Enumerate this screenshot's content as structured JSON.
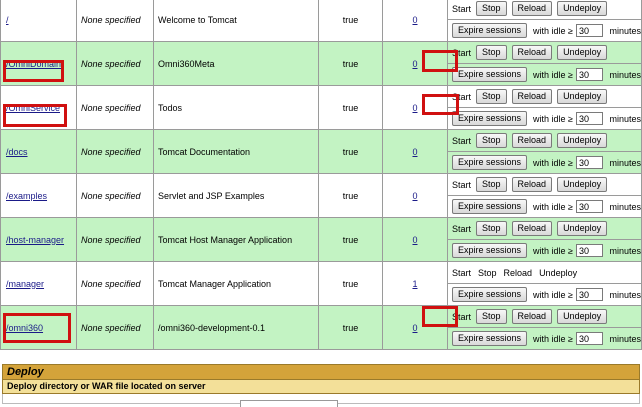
{
  "labels": {
    "start": "Start",
    "stop": "Stop",
    "reload": "Reload",
    "undeploy": "Undeploy",
    "expire": "Expire sessions",
    "with_idle": "with idle ≥",
    "minutes": "minutes",
    "idle_default": "30"
  },
  "apps": [
    {
      "path": "/",
      "version": "None specified",
      "display": "Welcome to Tomcat",
      "running": "true",
      "sessions": "0",
      "style": "white",
      "stop_disabled": false
    },
    {
      "path": "/OmniDomain",
      "version": "None specified",
      "display": "Omni360Meta",
      "running": "true",
      "sessions": "0",
      "style": "green",
      "stop_disabled": false
    },
    {
      "path": "/OmniService",
      "version": "None specified",
      "display": "Todos",
      "running": "true",
      "sessions": "0",
      "style": "white",
      "stop_disabled": false
    },
    {
      "path": "/docs",
      "version": "None specified",
      "display": "Tomcat Documentation",
      "running": "true",
      "sessions": "0",
      "style": "green",
      "stop_disabled": false
    },
    {
      "path": "/examples",
      "version": "None specified",
      "display": "Servlet and JSP Examples",
      "running": "true",
      "sessions": "0",
      "style": "white",
      "stop_disabled": false
    },
    {
      "path": "/host-manager",
      "version": "None specified",
      "display": "Tomcat Host Manager Application",
      "running": "true",
      "sessions": "0",
      "style": "green",
      "stop_disabled": false
    },
    {
      "path": "/manager",
      "version": "None specified",
      "display": "Tomcat Manager Application",
      "running": "true",
      "sessions": "1",
      "style": "white",
      "stop_disabled": true
    },
    {
      "path": "/omni360",
      "version": "None specified",
      "display": "/omni360-development-0.1",
      "running": "true",
      "sessions": "0",
      "style": "green",
      "stop_disabled": false
    }
  ],
  "deploy": {
    "title": "Deploy",
    "subtitle": "Deploy directory or WAR file located on server"
  }
}
